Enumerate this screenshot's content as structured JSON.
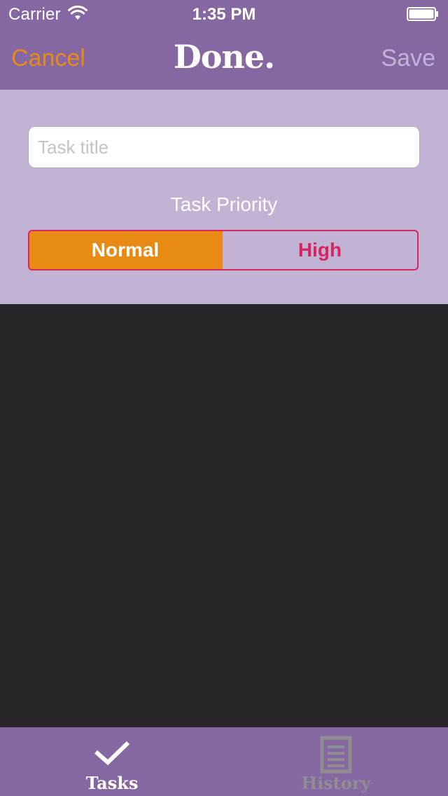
{
  "status_bar": {
    "carrier": "Carrier",
    "time": "1:35 PM"
  },
  "nav": {
    "cancel_label": "Cancel",
    "title": "Done.",
    "save_label": "Save"
  },
  "form": {
    "title_placeholder": "Task title",
    "title_value": "",
    "priority_label": "Task Priority",
    "priority_options": [
      "Normal",
      "High"
    ],
    "selected_priority": "Normal"
  },
  "tab_bar": {
    "tabs": [
      {
        "label": "Tasks",
        "icon": "checkmark-icon",
        "active": true
      },
      {
        "label": "History",
        "icon": "document-list-icon",
        "active": false
      }
    ]
  },
  "colors": {
    "nav_background": "#8567a2",
    "form_background": "#c2b3d5",
    "content_background": "#28262b",
    "accent_orange": "#e88a14",
    "accent_pink": "#d6255f"
  }
}
